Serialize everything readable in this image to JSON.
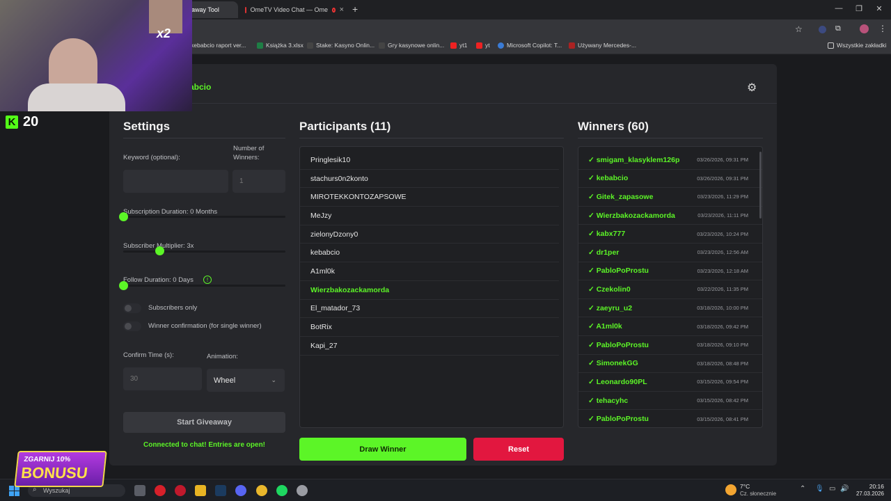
{
  "browser": {
    "tabs": [
      {
        "title": "eaway Tool",
        "active": true
      },
      {
        "title": "OmeTV Video Chat — Ome",
        "active": false
      }
    ],
    "new_tab": "+",
    "bookmarks": [
      "kebabcio raport ver...",
      "Książka 3.xlsx",
      "Stake: Kasyno Onlin...",
      "Gry kasynowe onlin...",
      "yt1",
      "yt",
      "Microsoft Copilot: T...",
      "Używany Mercedes-..."
    ],
    "bookmarks_all": "Wszystkie zakładki"
  },
  "app": {
    "channel_name": "abcio",
    "settings": {
      "title": "Settings",
      "keyword_label": "Keyword (optional):",
      "winners_label": "Number of Winners:",
      "winners_value": "1",
      "sub_duration_label": "Subscription Duration: 0 Months",
      "sub_multiplier_label": "Subscriber Multiplier: 3x",
      "follow_duration_label": "Follow Duration:  0  Days",
      "sub_duration_value": 0,
      "sub_multiplier_value": 3,
      "follow_duration_value": 0,
      "subscribers_only_label": "Subscribers only",
      "subscribers_only": false,
      "winner_confirmation_label": "Winner confirmation (for single winner)",
      "winner_confirmation": false,
      "confirm_time_label": "Confirm Time (s):",
      "confirm_time_value": "30",
      "animation_label": "Animation:",
      "animation_value": "Wheel",
      "start_button": "Start Giveaway",
      "status": "Connected to chat! Entries are open!"
    },
    "participants": {
      "title": "Participants (11)",
      "items": [
        {
          "name": "Pringlesik10",
          "highlight": false
        },
        {
          "name": "stachurs0n2konto",
          "highlight": false
        },
        {
          "name": "MIROTEKKONTOZAPSOWE",
          "highlight": false
        },
        {
          "name": "MeJzy",
          "highlight": false
        },
        {
          "name": "zielonyDzony0",
          "highlight": false
        },
        {
          "name": "kebabcio",
          "highlight": false
        },
        {
          "name": "A1ml0k",
          "highlight": false
        },
        {
          "name": "Wierzbakozackamorda",
          "highlight": true
        },
        {
          "name": "El_matador_73",
          "highlight": false
        },
        {
          "name": "BotRix",
          "highlight": false
        },
        {
          "name": "Kapi_27",
          "highlight": false
        }
      ],
      "draw_button": "Draw Winner",
      "reset_button": "Reset"
    },
    "winners": {
      "title": "Winners (60)",
      "items": [
        {
          "name": "✓ smigam_klasyklem126p",
          "date": "03/26/2026, 09:31 PM"
        },
        {
          "name": "✓ kebabcio",
          "date": "03/26/2026, 09:31 PM"
        },
        {
          "name": "✓ Gitek_zapasowe",
          "date": "03/23/2026, 11:29 PM"
        },
        {
          "name": "✓ Wierzbakozackamorda",
          "date": "03/23/2026, 11:11 PM"
        },
        {
          "name": "✓ kabx777",
          "date": "03/23/2026, 10:24 PM"
        },
        {
          "name": "✓ dr1per",
          "date": "03/23/2026, 12:56 AM"
        },
        {
          "name": "✓ PabloPoProstu",
          "date": "03/23/2026, 12:18 AM"
        },
        {
          "name": "✓ Czekolin0",
          "date": "03/22/2026, 11:35 PM"
        },
        {
          "name": "✓ zaeyru_u2",
          "date": "03/18/2026, 10:00 PM"
        },
        {
          "name": "✓ A1ml0k",
          "date": "03/18/2026, 09:42 PM"
        },
        {
          "name": "✓ PabloPoProstu",
          "date": "03/18/2026, 09:10 PM"
        },
        {
          "name": "✓ SimonekGG",
          "date": "03/18/2026, 08:48 PM"
        },
        {
          "name": "✓ Leonardo90PL",
          "date": "03/15/2026, 09:54 PM"
        },
        {
          "name": "✓ tehacyhc",
          "date": "03/15/2026, 08:42 PM"
        },
        {
          "name": "✓ PabloPoProstu",
          "date": "03/15/2026, 08:41 PM"
        }
      ]
    },
    "colors": {
      "accent": "#5cf527",
      "reset": "#e2173f"
    }
  },
  "overlay": {
    "kick_count": "20",
    "multiplier": "x2",
    "promo_line1": "ZGARNIJ 10%",
    "promo_line2": "BONUSU"
  },
  "taskbar": {
    "search_placeholder": "Wyszukaj",
    "weather_temp": "7°C",
    "weather_desc": "Cz. słonecznie",
    "time": "20:16",
    "date": "27.03.2026"
  }
}
